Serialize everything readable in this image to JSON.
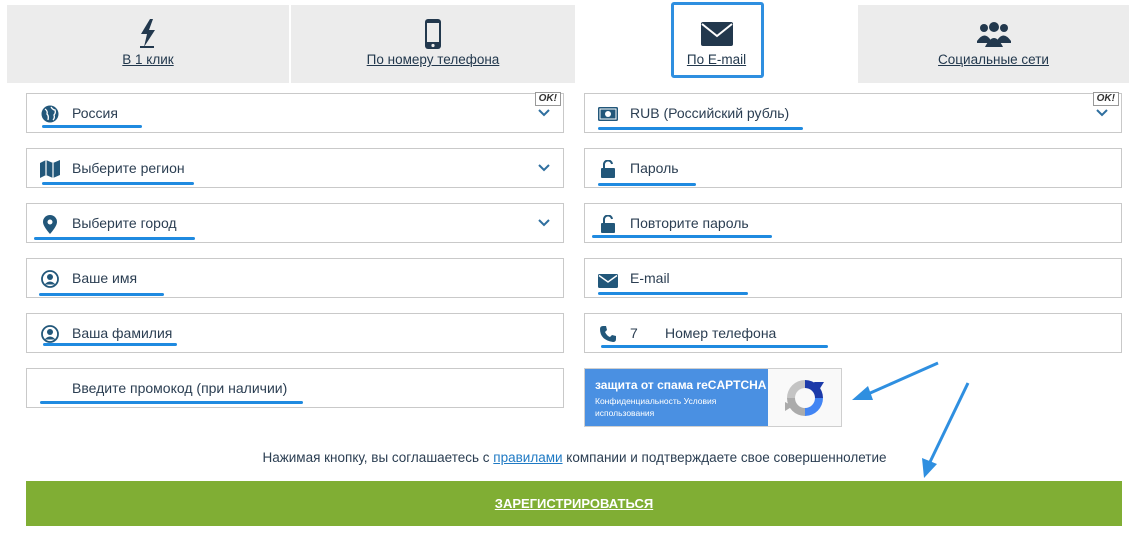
{
  "tabs": [
    {
      "label": "В 1 клик",
      "icon": "lightning-icon"
    },
    {
      "label": "По номеру телефона",
      "icon": "phone-icon"
    },
    {
      "label": "По E-mail",
      "icon": "envelope-icon",
      "active": true
    },
    {
      "label": "Социальные сети",
      "icon": "people-icon"
    }
  ],
  "left_fields": {
    "country": {
      "value": "Россия",
      "icon": "globe-icon",
      "badge": "OK!"
    },
    "region": {
      "placeholder": "Выберите регион",
      "icon": "map-icon"
    },
    "city": {
      "placeholder": "Выберите город",
      "icon": "location-pin-icon"
    },
    "first_name": {
      "placeholder": "Ваше имя",
      "icon": "user-icon"
    },
    "last_name": {
      "placeholder": "Ваша фамилия",
      "icon": "user-icon"
    },
    "promo": {
      "placeholder": "Введите промокод (при наличии)"
    }
  },
  "right_fields": {
    "currency": {
      "value": "RUB (Российский рубль)",
      "icon": "banknote-icon",
      "badge": "OK!"
    },
    "password": {
      "placeholder": "Пароль",
      "icon": "lock-icon"
    },
    "password_repeat": {
      "placeholder": "Повторите пароль",
      "icon": "lock-icon"
    },
    "email": {
      "placeholder": "E-mail",
      "icon": "envelope-icon"
    },
    "phone": {
      "prefix": "7",
      "placeholder": "Номер телефона",
      "icon": "phone-handset-icon"
    }
  },
  "captcha": {
    "title": "защита от спама reCAPTCHA",
    "privacy": "Конфиденциальность",
    "terms": "Условия использования"
  },
  "agreement": {
    "before": "Нажимая кнопку, вы соглашаетесь с ",
    "link": "правилами",
    "after": " компании и подтверждаете свое совершеннолетие"
  },
  "register_button": "ЗАРЕГИСТРИРОВАТЬСЯ",
  "colors": {
    "accent": "#1f8ae0",
    "icon": "#22577a",
    "button": "#80ae34",
    "tab_bg": "#ececec"
  }
}
